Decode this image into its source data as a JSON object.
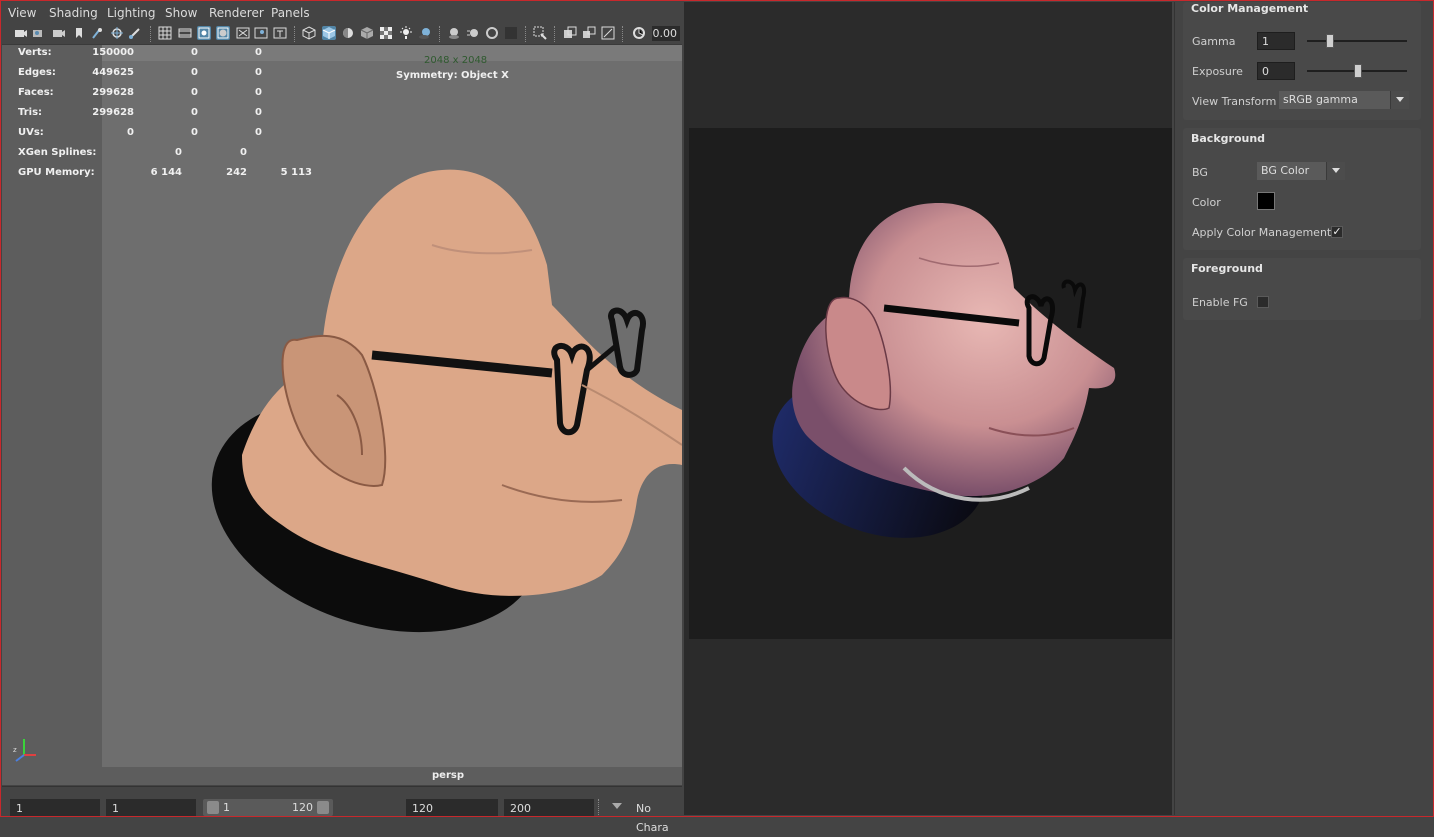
{
  "menubar": {
    "items": [
      "View",
      "Shading",
      "Lighting",
      "Show",
      "Renderer",
      "Panels"
    ]
  },
  "toolbar": {
    "camera_value": "0.00",
    "icons": [
      "select-camera-icon",
      "camera-attributes-icon",
      "bookmark-icon",
      "image-plane-icon",
      "two-d-pan-icon",
      "grease-pencil-icon",
      "grid-icon",
      "film-gate-icon",
      "resolution-gate-icon",
      "gate-mask-icon",
      "field-chart-icon",
      "safe-action-icon",
      "safe-title-icon",
      "wireframe-icon",
      "smooth-shade-icon",
      "default-material-icon",
      "textured-icon",
      "use-all-lights-icon",
      "shadows-icon",
      "screen-space-ao-icon",
      "motion-blur-icon",
      "multisample-aa-icon",
      "depth-of-field-icon",
      "isolate-select-icon",
      "xray-icon",
      "xray-joints-icon",
      "backface-icon",
      "exposure-icon"
    ]
  },
  "hud": {
    "rows": [
      {
        "label": "Verts:",
        "values": [
          "150000",
          "0",
          "0"
        ]
      },
      {
        "label": "Edges:",
        "values": [
          "449625",
          "0",
          "0"
        ]
      },
      {
        "label": "Faces:",
        "values": [
          "299628",
          "0",
          "0"
        ]
      },
      {
        "label": "Tris:",
        "values": [
          "299628",
          "0",
          "0"
        ]
      },
      {
        "label": "UVs:",
        "values": [
          "0",
          "0",
          "0"
        ]
      },
      {
        "label": "XGen Splines:",
        "values": [
          "0",
          "0"
        ]
      },
      {
        "label": "GPU Memory:",
        "values": [
          "6 144",
          "242",
          "5 113"
        ]
      }
    ],
    "resolution": "2048 x 2048",
    "symmetry": "Symmetry: Object X",
    "camera": "persp"
  },
  "timeline": {
    "start_field": "1",
    "current_field": "1",
    "range_start": "1",
    "range_end": "120",
    "end_field": "120",
    "max_field": "200",
    "character_set": "No Chara"
  },
  "attributes": {
    "color_management": {
      "title": "Color Management",
      "gamma_label": "Gamma",
      "gamma_value": "1",
      "gamma_slider": 0.22,
      "exposure_label": "Exposure",
      "exposure_value": "0",
      "exposure_slider": 0.5,
      "view_transform_label": "View Transform",
      "view_transform_value": "sRGB gamma"
    },
    "background": {
      "title": "Background",
      "bg_label": "BG",
      "bg_value": "BG Color",
      "color_label": "Color",
      "color_value": "#000000",
      "apply_cm_label": "Apply Color Management",
      "apply_cm_checked": true
    },
    "foreground": {
      "title": "Foreground",
      "enable_fg_label": "Enable FG",
      "enable_fg_checked": false
    }
  },
  "colors": {
    "frame_border": "#c8282c",
    "skin_viewport": "#dca788",
    "skin_render": "#d9a2a2",
    "accent": "#5285a6"
  }
}
